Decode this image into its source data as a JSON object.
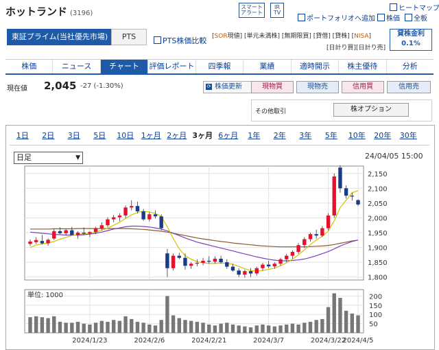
{
  "header": {
    "company": "ホットランド",
    "code": "(3196)",
    "smart_alert": [
      "スマート",
      "アラート"
    ],
    "ir_tv": [
      "IR",
      "TV"
    ],
    "heatmap": "ヒートマップ",
    "portfolio_add": "ポートフォリオへ追加",
    "stock_price": "株価",
    "full_board": "全板"
  },
  "market": {
    "active": "東証プライム(当社優先市場)",
    "pts": "PTS",
    "pts_compare": "PTS株価比較",
    "tags_row1": [
      "SOR",
      "現値",
      "単元未満株",
      "無期限買",
      "貸借",
      "貸株",
      "NISA"
    ],
    "tags_row2": [
      "日計り買",
      "日計り売"
    ],
    "margin_label": "貸株金利",
    "margin_rate": "0.1%"
  },
  "nav": [
    "株価",
    "ニュース",
    "チャート",
    "評価レポート",
    "四季報",
    "業績",
    "適時開示",
    "株主優待",
    "分析"
  ],
  "nav_active": 2,
  "quote": {
    "label": "現在値",
    "price": "2,045",
    "change": "-27 (-1.30%)",
    "refresh": "株価更新",
    "buttons": [
      "現物買",
      "現物売",
      "信用買",
      "信用売"
    ],
    "other_label": "その他取引",
    "option": "株オプション"
  },
  "chart_tabs": [
    "1日",
    "2日",
    "3日",
    "5日",
    "10日",
    "1ヶ月",
    "2ヶ月",
    "3ヶ月",
    "6ヶ月",
    "1年",
    "2年",
    "3年",
    "5年",
    "10年",
    "20年",
    "30年"
  ],
  "chart_tab_active": 7,
  "chart_select": "日足",
  "chart_datetime": "24/04/05 15:00",
  "colors": {
    "up": "#e8102d",
    "down": "#1a3a8c",
    "ma_short": "#d4c200",
    "ma_mid": "#7a3fc4",
    "ma_long": "#8a5a2b",
    "volume": "#777777",
    "accent": "#1e5aa8"
  },
  "chart_data": [
    {
      "type": "candlestick",
      "y_ticks": [
        "2,150",
        "2,100",
        "2,050",
        "2,000",
        "1,950",
        "1,900",
        "1,850",
        "1,800"
      ],
      "ylim": [
        1790,
        2175
      ],
      "x_labels": [
        "2024/1/23",
        "2024/2/6",
        "2024/2/21",
        "2024/3/7",
        "2024/3/22",
        "2024/4/5"
      ],
      "candles": [
        [
          1912,
          1927,
          1905,
          1920
        ],
        [
          1918,
          1935,
          1912,
          1925
        ],
        [
          1922,
          1942,
          1910,
          1914
        ],
        [
          1914,
          1930,
          1906,
          1926
        ],
        [
          1930,
          1962,
          1925,
          1955
        ],
        [
          1955,
          1968,
          1945,
          1948
        ],
        [
          1948,
          1962,
          1940,
          1958
        ],
        [
          1958,
          1970,
          1948,
          1942
        ],
        [
          1942,
          1955,
          1930,
          1950
        ],
        [
          1950,
          1968,
          1942,
          1947
        ],
        [
          1947,
          1955,
          1935,
          1952
        ],
        [
          1952,
          1970,
          1945,
          1965
        ],
        [
          1965,
          1985,
          1958,
          1975
        ],
        [
          1975,
          2002,
          1968,
          1995
        ],
        [
          1995,
          2010,
          1985,
          2002
        ],
        [
          2002,
          2015,
          1988,
          2008
        ],
        [
          2008,
          2042,
          2000,
          2035
        ],
        [
          2035,
          2060,
          2025,
          2040
        ],
        [
          2040,
          2055,
          2015,
          2022
        ],
        [
          2022,
          2030,
          1990,
          1995
        ],
        [
          1995,
          2020,
          1988,
          2012
        ],
        [
          2012,
          2025,
          1998,
          2005
        ],
        [
          2005,
          2012,
          1958,
          1965
        ],
        [
          1880,
          1895,
          1800,
          1830
        ],
        [
          1830,
          1880,
          1822,
          1872
        ],
        [
          1872,
          1882,
          1860,
          1865
        ],
        [
          1865,
          1880,
          1825,
          1838
        ],
        [
          1838,
          1850,
          1828,
          1845
        ],
        [
          1845,
          1860,
          1836,
          1848
        ],
        [
          1848,
          1865,
          1840,
          1855
        ],
        [
          1855,
          1870,
          1845,
          1852
        ],
        [
          1852,
          1870,
          1845,
          1862
        ],
        [
          1862,
          1872,
          1845,
          1850
        ],
        [
          1850,
          1860,
          1828,
          1835
        ],
        [
          1835,
          1845,
          1818,
          1822
        ],
        [
          1822,
          1830,
          1800,
          1808
        ],
        [
          1808,
          1825,
          1798,
          1820
        ],
        [
          1820,
          1830,
          1800,
          1812
        ],
        [
          1812,
          1835,
          1805,
          1830
        ],
        [
          1830,
          1848,
          1822,
          1842
        ],
        [
          1842,
          1855,
          1830,
          1836
        ],
        [
          1836,
          1850,
          1828,
          1845
        ],
        [
          1845,
          1865,
          1838,
          1860
        ],
        [
          1860,
          1878,
          1850,
          1872
        ],
        [
          1872,
          1890,
          1862,
          1885
        ],
        [
          1885,
          1915,
          1878,
          1908
        ],
        [
          1908,
          1935,
          1898,
          1928
        ],
        [
          1928,
          1950,
          1920,
          1945
        ],
        [
          1945,
          1960,
          1930,
          1940
        ],
        [
          1940,
          1972,
          1935,
          1965
        ],
        [
          1965,
          2015,
          1958,
          2008
        ],
        [
          2008,
          2150,
          2000,
          2140
        ],
        [
          2170,
          2178,
          2085,
          2100
        ],
        [
          2100,
          2110,
          2065,
          2075
        ],
        [
          2075,
          2085,
          2058,
          2072
        ],
        [
          2060,
          2062,
          2040,
          2045
        ]
      ],
      "ma_short": [
        1900,
        1908,
        1912,
        1915,
        1920,
        1928,
        1934,
        1940,
        1944,
        1946,
        1948,
        1952,
        1958,
        1965,
        1975,
        1985,
        1998,
        2010,
        2018,
        2022,
        2020,
        2015,
        2005,
        1970,
        1930,
        1895,
        1872,
        1860,
        1852,
        1848,
        1846,
        1846,
        1847,
        1846,
        1843,
        1836,
        1828,
        1822,
        1820,
        1822,
        1826,
        1830,
        1838,
        1848,
        1860,
        1875,
        1892,
        1910,
        1925,
        1938,
        1955,
        1990,
        2035,
        2060,
        2085,
        2092
      ],
      "ma_mid": [
        1952,
        1950,
        1948,
        1946,
        1944,
        1943,
        1942,
        1942,
        1942,
        1943,
        1945,
        1948,
        1952,
        1957,
        1962,
        1966,
        1970,
        1972,
        1972,
        1971,
        1969,
        1966,
        1962,
        1956,
        1948,
        1940,
        1932,
        1925,
        1918,
        1913,
        1908,
        1903,
        1898,
        1893,
        1888,
        1883,
        1878,
        1873,
        1868,
        1864,
        1860,
        1857,
        1855,
        1855,
        1856,
        1858,
        1861,
        1866,
        1872,
        1879,
        1886,
        1895,
        1905,
        1913,
        1920,
        1925
      ],
      "ma_long": [
        1962,
        1962,
        1962,
        1962,
        1963,
        1963,
        1963,
        1963,
        1964,
        1964,
        1964,
        1964,
        1964,
        1964,
        1964,
        1964,
        1964,
        1963,
        1962,
        1961,
        1959,
        1957,
        1955,
        1952,
        1948,
        1944,
        1940,
        1936,
        1932,
        1929,
        1926,
        1923,
        1920,
        1918,
        1915,
        1913,
        1911,
        1909,
        1907,
        1905,
        1904,
        1903,
        1902,
        1902,
        1902,
        1902,
        1902,
        1903,
        1904,
        1905,
        1907,
        1910,
        1914,
        1918,
        1922,
        1925
      ]
    },
    {
      "type": "bar",
      "unit": "単位: 1000",
      "y_ticks": [
        "200",
        "150",
        "100",
        "50"
      ],
      "ylim": [
        0,
        235
      ],
      "values": [
        85,
        90,
        85,
        80,
        90,
        60,
        55,
        55,
        60,
        50,
        45,
        55,
        65,
        60,
        70,
        65,
        90,
        75,
        60,
        55,
        45,
        40,
        70,
        200,
        95,
        80,
        70,
        65,
        60,
        55,
        45,
        40,
        50,
        55,
        45,
        40,
        35,
        30,
        40,
        45,
        40,
        35,
        40,
        45,
        50,
        45,
        55,
        60,
        70,
        75,
        140,
        215,
        190,
        120,
        105,
        95
      ]
    }
  ]
}
